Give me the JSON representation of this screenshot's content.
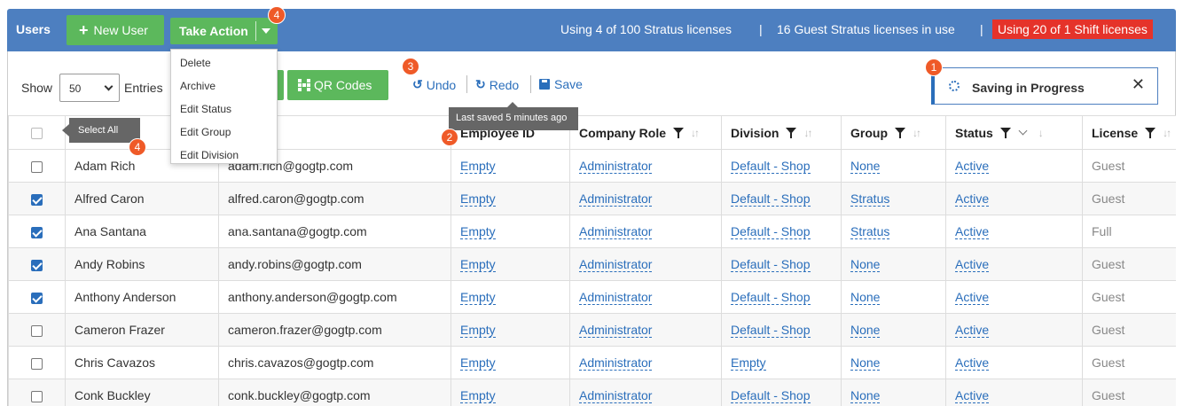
{
  "header": {
    "title": "Users",
    "new_user": "New User",
    "take_action": "Take Action",
    "license_stratus": "Using 4 of 100 Stratus licenses",
    "divider": "|",
    "license_guest": "16 Guest Stratus licenses in use",
    "license_shift": "Using 20 of 1 Shift licenses"
  },
  "badges": {
    "b1": "1",
    "b2": "2",
    "b3": "3",
    "b4": "4"
  },
  "dropdown": {
    "items": [
      "Delete",
      "Archive",
      "Edit Status",
      "Edit Group",
      "Edit Division"
    ]
  },
  "toolbar": {
    "show": "Show",
    "entries_value": "50",
    "entries": "Entries",
    "qr_codes": "QR Codes",
    "undo": "Undo",
    "redo": "Redo",
    "save": "Save"
  },
  "tooltips": {
    "last_saved": "Last saved 5 minutes ago",
    "select_all": "Select All"
  },
  "saving": {
    "text": "Saving in Progress",
    "close": "✕"
  },
  "columns": {
    "employee_id": "Employee ID",
    "company_role": "Company Role",
    "division": "Division",
    "group": "Group",
    "status": "Status",
    "license": "License"
  },
  "rows": [
    {
      "checked": false,
      "name": "Adam Rich",
      "email": "adam.rich@gogtp.com",
      "emp": "Empty",
      "role": "Administrator",
      "division": "Default - Shop",
      "group": "None",
      "status": "Active",
      "license": "Guest"
    },
    {
      "checked": true,
      "name": "Alfred Caron",
      "email": "alfred.caron@gogtp.com",
      "emp": "Empty",
      "role": "Administrator",
      "division": "Default - Shop",
      "group": "Stratus",
      "status": "Active",
      "license": "Guest"
    },
    {
      "checked": true,
      "name": "Ana Santana",
      "email": "ana.santana@gogtp.com",
      "emp": "Empty",
      "role": "Administrator",
      "division": "Default - Shop",
      "group": "Stratus",
      "status": "Active",
      "license": "Full"
    },
    {
      "checked": true,
      "name": "Andy Robins",
      "email": "andy.robins@gogtp.com",
      "emp": "Empty",
      "role": "Administrator",
      "division": "Default - Shop",
      "group": "None",
      "status": "Active",
      "license": "Guest"
    },
    {
      "checked": true,
      "name": "Anthony Anderson",
      "email": "anthony.anderson@gogtp.com",
      "emp": "Empty",
      "role": "Administrator",
      "division": "Default - Shop",
      "group": "None",
      "status": "Active",
      "license": "Guest"
    },
    {
      "checked": false,
      "name": "Cameron Frazer",
      "email": "cameron.frazer@gogtp.com",
      "emp": "Empty",
      "role": "Administrator",
      "division": "Default - Shop",
      "group": "None",
      "status": "Active",
      "license": "Guest"
    },
    {
      "checked": false,
      "name": "Chris Cavazos",
      "email": "chris.cavazos@gogtp.com",
      "emp": "Empty",
      "role": "Administrator",
      "division": "Empty",
      "group": "None",
      "status": "Active",
      "license": "Guest"
    },
    {
      "checked": false,
      "name": "Conk Buckley",
      "email": "conk.buckley@gogtp.com",
      "emp": "Empty",
      "role": "Administrator",
      "division": "Default - Shop",
      "group": "None",
      "status": "Active",
      "license": "Guest"
    }
  ],
  "colors": {
    "header_bg": "#4d7fc0",
    "button_green": "#5cb85c",
    "alert_red": "#e5332a",
    "badge_orange": "#ef5a28",
    "link_blue": "#2a6ebb"
  }
}
